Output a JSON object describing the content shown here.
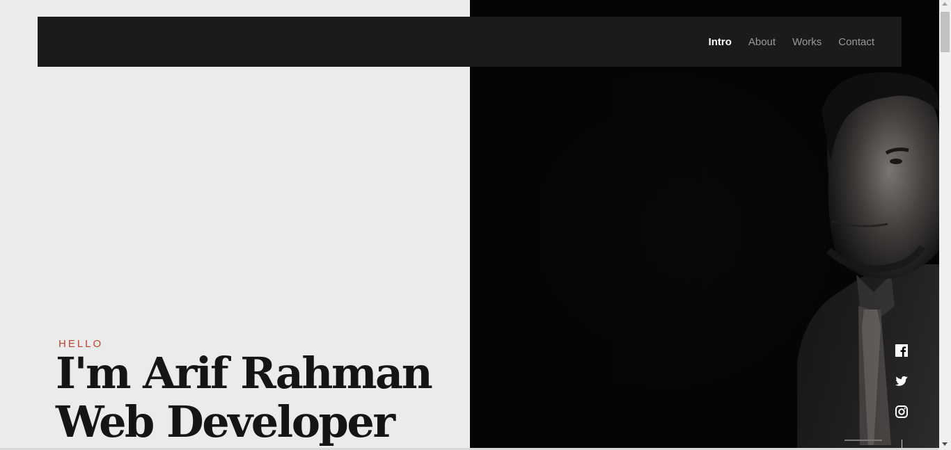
{
  "nav": {
    "items": [
      {
        "label": "Intro",
        "active": true
      },
      {
        "label": "About",
        "active": false
      },
      {
        "label": "Works",
        "active": false
      },
      {
        "label": "Contact",
        "active": false
      }
    ]
  },
  "hero": {
    "eyebrow": "HELLO",
    "line1": "I'm Arif Rahman",
    "line2": "Web Developer"
  },
  "social": [
    "facebook-icon",
    "twitter-icon",
    "instagram-icon"
  ],
  "colors": {
    "accent": "#c4412b",
    "left_bg": "#eaeceb",
    "nav_bg": "#1b1b1b",
    "right_bg": "#050506"
  }
}
